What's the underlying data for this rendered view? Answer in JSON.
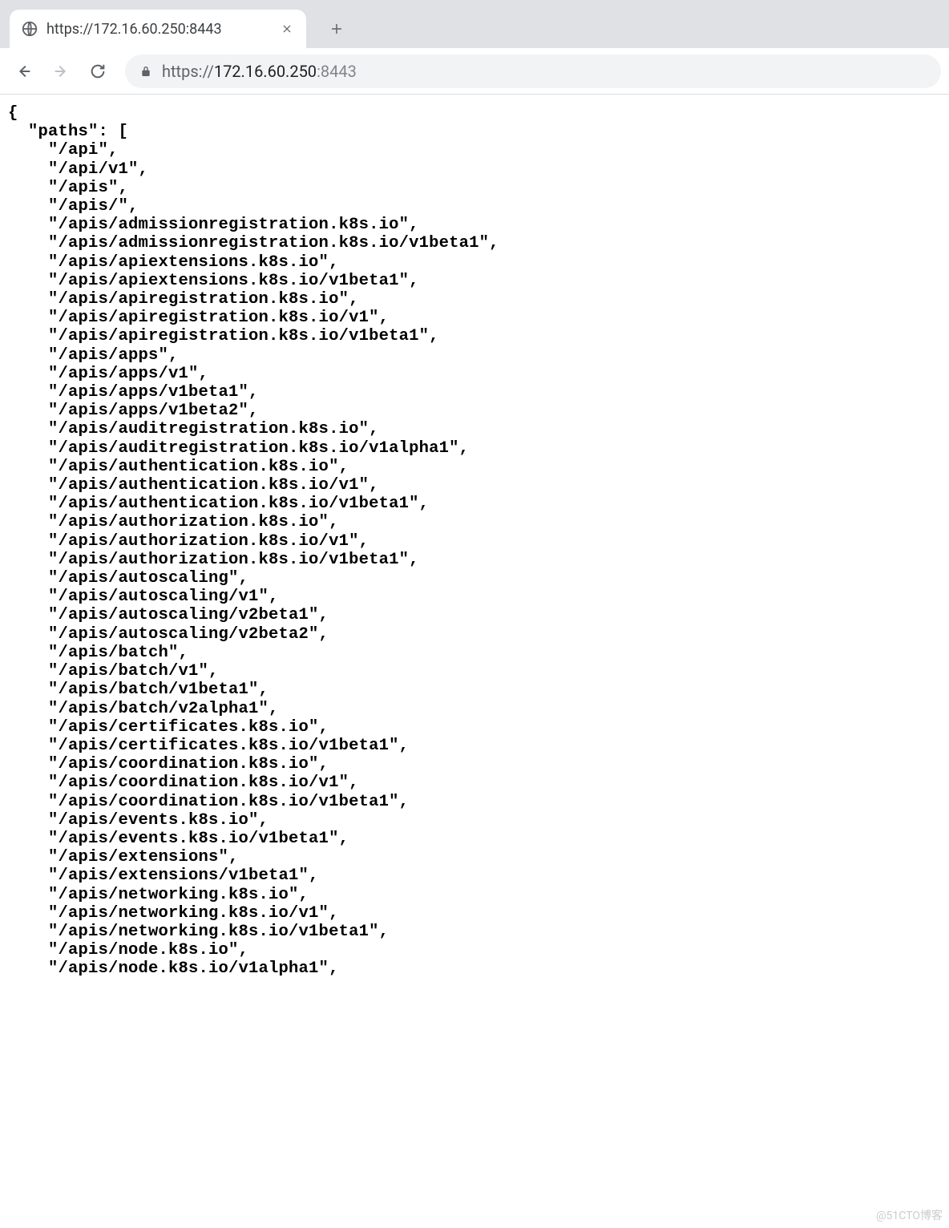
{
  "tab": {
    "title": "https://172.16.60.250:8443"
  },
  "address": {
    "protocol": "https://",
    "host": "172.16.60.250",
    "port": ":8443"
  },
  "json_body": {
    "key_label": "\"paths\"",
    "paths": [
      "/api",
      "/api/v1",
      "/apis",
      "/apis/",
      "/apis/admissionregistration.k8s.io",
      "/apis/admissionregistration.k8s.io/v1beta1",
      "/apis/apiextensions.k8s.io",
      "/apis/apiextensions.k8s.io/v1beta1",
      "/apis/apiregistration.k8s.io",
      "/apis/apiregistration.k8s.io/v1",
      "/apis/apiregistration.k8s.io/v1beta1",
      "/apis/apps",
      "/apis/apps/v1",
      "/apis/apps/v1beta1",
      "/apis/apps/v1beta2",
      "/apis/auditregistration.k8s.io",
      "/apis/auditregistration.k8s.io/v1alpha1",
      "/apis/authentication.k8s.io",
      "/apis/authentication.k8s.io/v1",
      "/apis/authentication.k8s.io/v1beta1",
      "/apis/authorization.k8s.io",
      "/apis/authorization.k8s.io/v1",
      "/apis/authorization.k8s.io/v1beta1",
      "/apis/autoscaling",
      "/apis/autoscaling/v1",
      "/apis/autoscaling/v2beta1",
      "/apis/autoscaling/v2beta2",
      "/apis/batch",
      "/apis/batch/v1",
      "/apis/batch/v1beta1",
      "/apis/batch/v2alpha1",
      "/apis/certificates.k8s.io",
      "/apis/certificates.k8s.io/v1beta1",
      "/apis/coordination.k8s.io",
      "/apis/coordination.k8s.io/v1",
      "/apis/coordination.k8s.io/v1beta1",
      "/apis/events.k8s.io",
      "/apis/events.k8s.io/v1beta1",
      "/apis/extensions",
      "/apis/extensions/v1beta1",
      "/apis/networking.k8s.io",
      "/apis/networking.k8s.io/v1",
      "/apis/networking.k8s.io/v1beta1",
      "/apis/node.k8s.io",
      "/apis/node.k8s.io/v1alpha1"
    ]
  },
  "watermark": "@51CTO博客"
}
